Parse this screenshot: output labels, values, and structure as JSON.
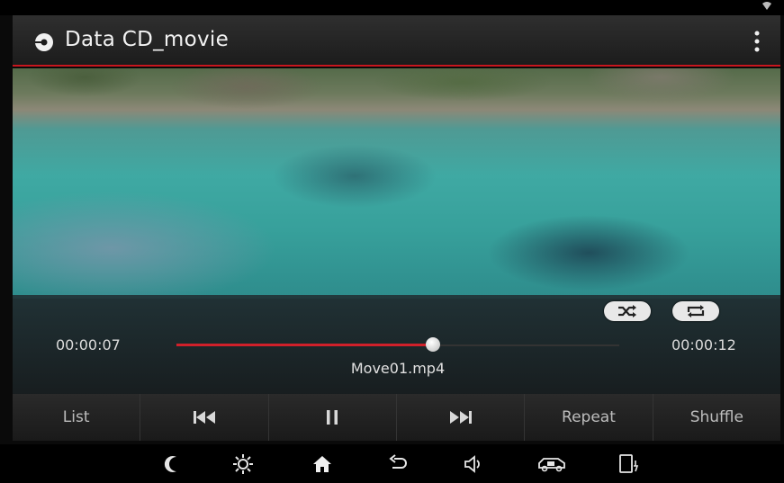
{
  "header": {
    "title": "Data CD_movie"
  },
  "player": {
    "elapsed": "00:00:07",
    "total": "00:00:12",
    "progress": 0.58,
    "filename": "Move01.mp4"
  },
  "toolbar": {
    "list_label": "List",
    "repeat_label": "Repeat",
    "shuffle_label": "Shuffle"
  },
  "icons": {
    "top_menu": "more-vert-icon",
    "status": "wifi-icon",
    "source": "disc-icon",
    "shuffle_toggle": "shuffle-icon",
    "repeat_toggle": "repeat-icon",
    "prev": "skip-previous-icon",
    "pause": "pause-icon",
    "next": "skip-next-icon",
    "nav": [
      "night-mode-icon",
      "brightness-icon",
      "home-icon",
      "back-icon",
      "volume-icon",
      "car-icon",
      "phone-icon"
    ]
  },
  "colors": {
    "accent": "#c8161e",
    "progress": "#d0202a"
  }
}
